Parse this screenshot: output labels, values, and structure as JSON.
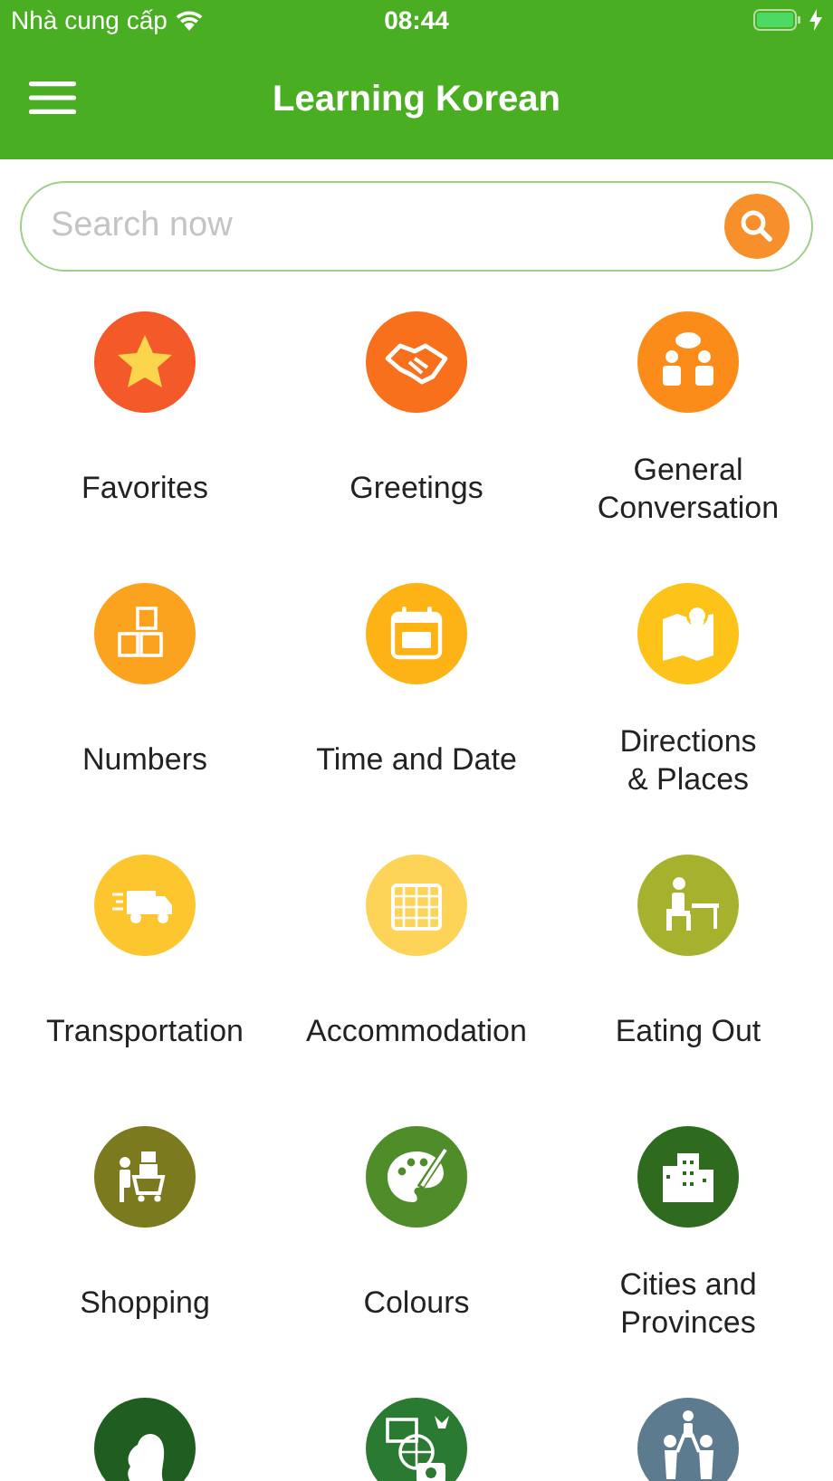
{
  "status_bar": {
    "carrier": "Nhà cung cấp",
    "time": "08:44"
  },
  "header": {
    "title": "Learning Korean"
  },
  "search": {
    "placeholder": "Search now"
  },
  "categories": [
    {
      "label": "Favorites",
      "color": "#f4592a"
    },
    {
      "label": "Greetings",
      "color": "#f9701c"
    },
    {
      "label": "General Conversation",
      "color": "#fb8c1a"
    },
    {
      "label": "Numbers",
      "color": "#fba21e"
    },
    {
      "label": "Time and Date",
      "color": "#fdb316"
    },
    {
      "label": "Directions & Places",
      "color": "#fec318"
    },
    {
      "label": "Transportation",
      "color": "#fdc62e"
    },
    {
      "label": "Accommodation",
      "color": "#fdd457"
    },
    {
      "label": "Eating Out",
      "color": "#a6b22e"
    },
    {
      "label": "Shopping",
      "color": "#7b7a1e"
    },
    {
      "label": "Colours",
      "color": "#4f8d2a"
    },
    {
      "label": "Cities and Provinces",
      "color": "#2f6b1f"
    },
    {
      "color": "#1f5e20"
    },
    {
      "color": "#2b7a32"
    },
    {
      "color": "#5d7b8e"
    }
  ]
}
